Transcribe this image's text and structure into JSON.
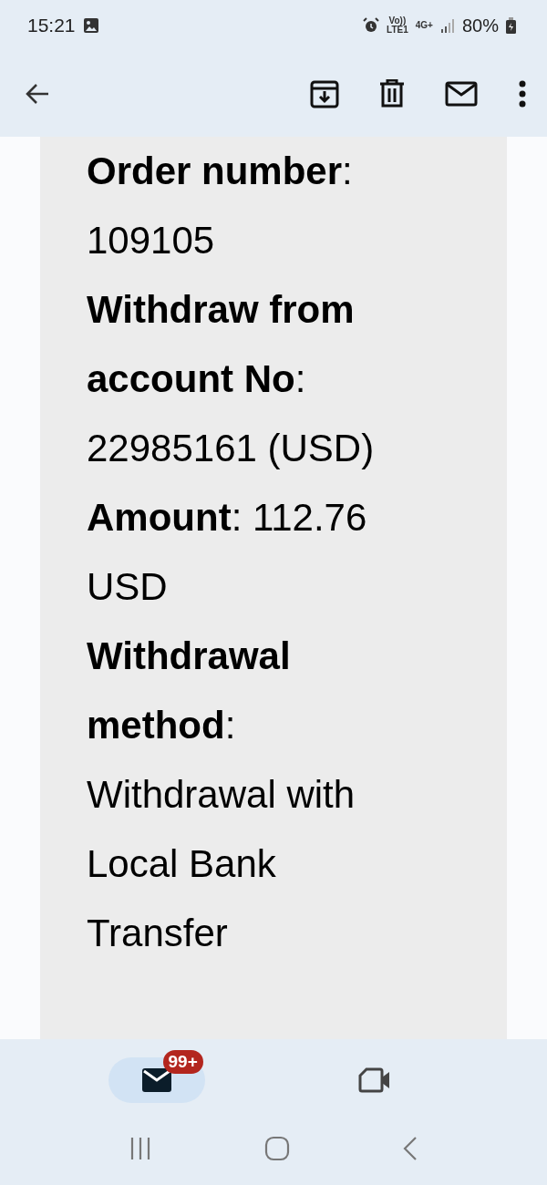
{
  "status_bar": {
    "time": "15:21",
    "volte": "Vo))",
    "lte": "LTE1",
    "network": "4G+",
    "battery": "80%"
  },
  "toolbar": {
    "actions": [
      {
        "kind": "archive"
      },
      {
        "kind": "delete"
      },
      {
        "kind": "unread"
      },
      {
        "kind": "more"
      }
    ]
  },
  "email_body": {
    "paragraphs": [
      {
        "text": "**Order number**: 109105"
      },
      {
        "text": "**Withdraw from account No**: 22985161 (USD)"
      },
      {
        "text": "**Amount**: 112.76 USD"
      },
      {
        "text": "**Withdrawal method**: Withdrawal with Local Bank Transfer"
      }
    ]
  },
  "bottom_nav": {
    "items": [
      {
        "kind": "mail",
        "selected": true,
        "badge": "99+"
      },
      {
        "kind": "video",
        "selected": false
      }
    ]
  }
}
